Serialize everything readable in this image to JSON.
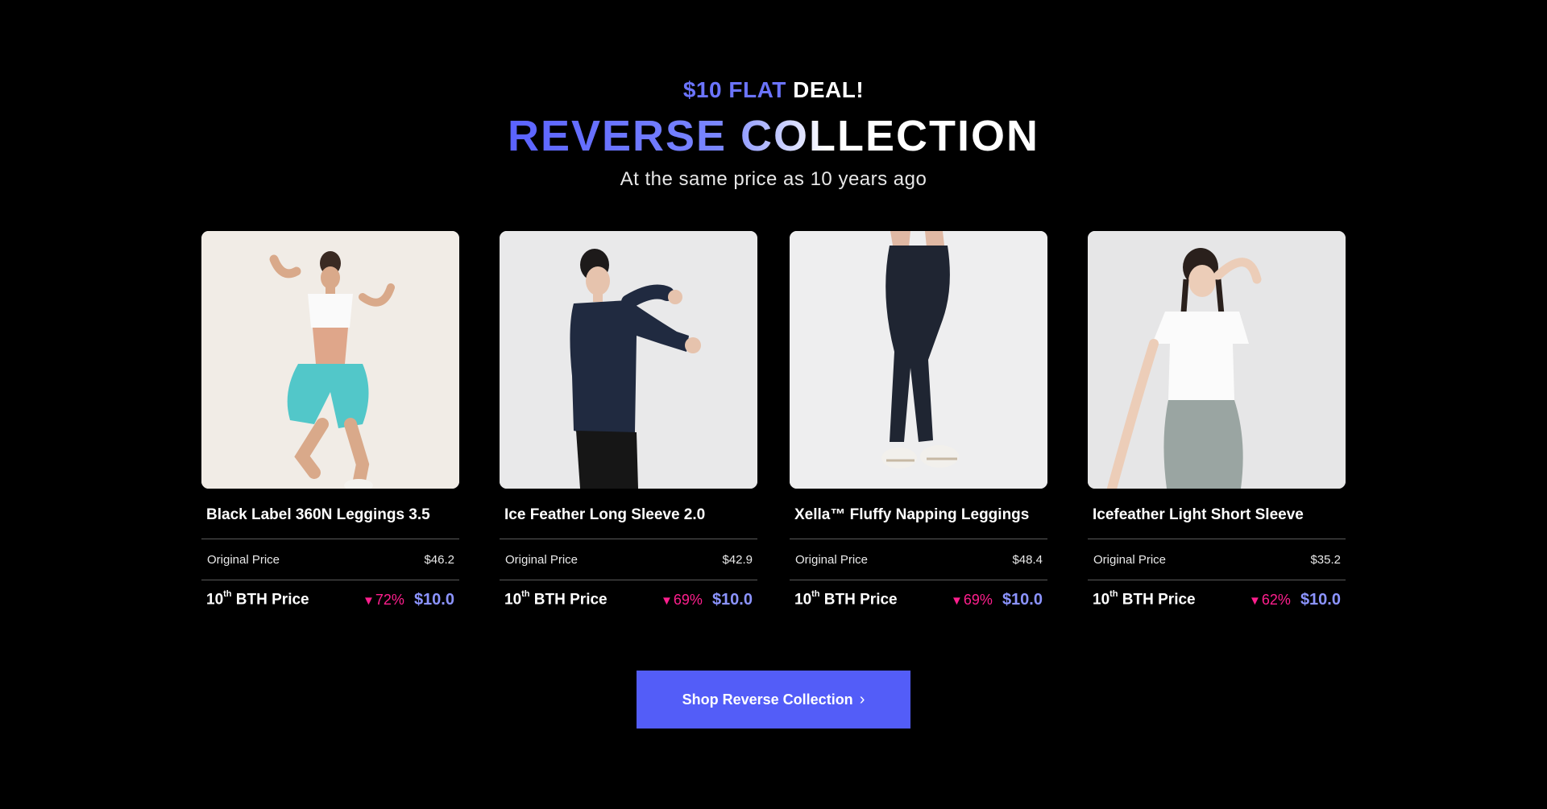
{
  "header": {
    "eyebrow_highlight": "$10 FLAT",
    "eyebrow_rest": "DEAL!",
    "title": "REVERSE COLLECTION",
    "subtitle": "At the same price as 10 years ago"
  },
  "products": [
    {
      "name": "Black Label 360N Leggings 3.5",
      "original_label": "Original Price",
      "original_price": "$46.2",
      "deal_label_num": "10",
      "deal_label_sup": "th",
      "deal_label_rest": " BTH Price",
      "discount": "72%",
      "deal_price": "$10.0"
    },
    {
      "name": "Ice Feather Long Sleeve 2.0",
      "original_label": "Original Price",
      "original_price": "$42.9",
      "deal_label_num": "10",
      "deal_label_sup": "th",
      "deal_label_rest": " BTH Price",
      "discount": "69%",
      "deal_price": "$10.0"
    },
    {
      "name": "Xella™ Fluffy Napping Leggings",
      "original_label": "Original Price",
      "original_price": "$48.4",
      "deal_label_num": "10",
      "deal_label_sup": "th",
      "deal_label_rest": " BTH Price",
      "discount": "69%",
      "deal_price": "$10.0"
    },
    {
      "name": "Icefeather Light Short Sleeve",
      "original_label": "Original Price",
      "original_price": "$35.2",
      "deal_label_num": "10",
      "deal_label_sup": "th",
      "deal_label_rest": " BTH Price",
      "discount": "62%",
      "deal_price": "$10.0"
    }
  ],
  "discount_icon": "down-triangle-icon",
  "cta": {
    "label": "Shop Reverse Collection",
    "icon": "chevron-right-icon"
  },
  "colors": {
    "background": "#000000",
    "accent": "#535df8",
    "deal_price": "#8c94ff",
    "discount": "#ff1f8e"
  }
}
